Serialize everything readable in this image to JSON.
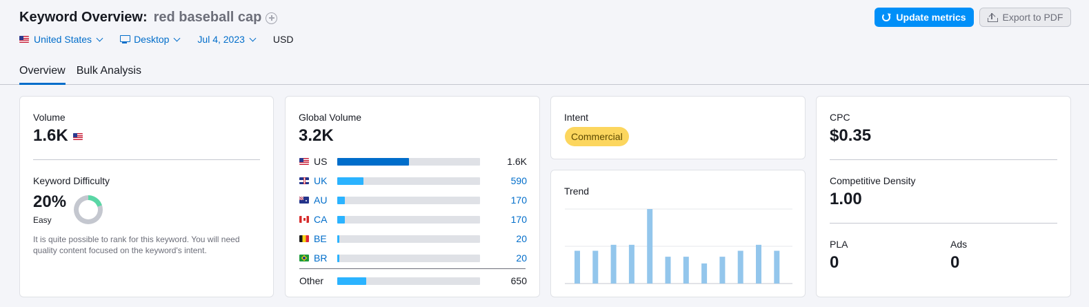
{
  "header": {
    "title": "Keyword Overview:",
    "keyword": "red baseball cap",
    "update_label": "Update metrics",
    "export_label": "Export to PDF"
  },
  "filters": {
    "country": "United States",
    "device": "Desktop",
    "date": "Jul 4, 2023",
    "currency": "USD"
  },
  "tabs": [
    {
      "label": "Overview",
      "active": true
    },
    {
      "label": "Bulk Analysis",
      "active": false
    }
  ],
  "volume": {
    "label": "Volume",
    "value": "1.6K",
    "flag": "us-flag-icon"
  },
  "keyword_difficulty": {
    "label": "Keyword Difficulty",
    "value": "20%",
    "percent": 20,
    "level": "Easy",
    "description": "It is quite possible to rank for this keyword. You will need quality content focused on the keyword's intent."
  },
  "global_volume": {
    "label": "Global Volume",
    "value": "3.2K",
    "rows": [
      {
        "code": "US",
        "value": "1.6K",
        "share": 0.5,
        "linked": false
      },
      {
        "code": "UK",
        "value": "590",
        "share": 0.185,
        "linked": true
      },
      {
        "code": "AU",
        "value": "170",
        "share": 0.053,
        "linked": true
      },
      {
        "code": "CA",
        "value": "170",
        "share": 0.053,
        "linked": true
      },
      {
        "code": "BE",
        "value": "20",
        "share": 0.01,
        "linked": true
      },
      {
        "code": "BR",
        "value": "20",
        "share": 0.01,
        "linked": true
      }
    ],
    "other": {
      "label": "Other",
      "value": "650",
      "share": 0.203
    }
  },
  "intent": {
    "label": "Intent",
    "value": "Commercial",
    "color": "#fcd65e"
  },
  "trend": {
    "label": "Trend"
  },
  "chart_data": {
    "type": "bar",
    "title": "",
    "values": [
      0.44,
      0.44,
      0.52,
      0.52,
      1.0,
      0.36,
      0.36,
      0.27,
      0.36,
      0.44,
      0.52,
      0.44
    ],
    "ylim": [
      0,
      1
    ],
    "color": "#93c6ec",
    "grid": true
  },
  "cpc": {
    "label": "CPC",
    "value": "$0.35"
  },
  "competitive_density": {
    "label": "Competitive Density",
    "value": "1.00"
  },
  "pla": {
    "label": "PLA",
    "value": "0"
  },
  "ads": {
    "label": "Ads",
    "value": "0"
  },
  "colors": {
    "accent": "#006dca",
    "primary_button": "#008ff8",
    "us_bar": "#006dca",
    "bar": "#2bb3ff"
  }
}
